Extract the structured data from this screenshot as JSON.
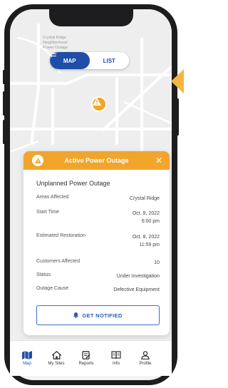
{
  "toggle": {
    "map_label": "MAP",
    "list_label": "LIST",
    "active": "map"
  },
  "map": {
    "labels": [
      "Crystal Ridge",
      "Neighborhood",
      "Power Outage"
    ],
    "marker": {
      "icon": "warning-icon",
      "color": "#f2a52b"
    }
  },
  "card": {
    "title": "Active Power Outage",
    "close_label": "✕",
    "outage_type": "Unplanned Power Outage",
    "details": [
      {
        "key": "Areas Affected",
        "value": "Crystal Ridge"
      },
      {
        "key": "Start Time",
        "value": "Oct. 8, 2022",
        "value2": "6:00 pm"
      },
      {
        "key": "Estimated Restoration",
        "value": "Oct. 8, 2022",
        "value2": "11:59 pm"
      },
      {
        "key": "Customers Affected",
        "value": "10"
      },
      {
        "key": "Status",
        "value": "Under Investigation"
      },
      {
        "key": "Outage Cause",
        "value": "Defective Equipment"
      }
    ],
    "button_label": "GET NOTIFIED"
  },
  "tabs": [
    {
      "label": "Map",
      "icon": "map-icon"
    },
    {
      "label": "My Sites",
      "icon": "home-icon"
    },
    {
      "label": "Reports",
      "icon": "reports-icon"
    },
    {
      "label": "Info",
      "icon": "book-icon"
    },
    {
      "label": "Profile",
      "icon": "profile-icon"
    }
  ],
  "colors": {
    "brand_blue": "#1f4ea8",
    "alert_orange": "#f2a52b"
  }
}
